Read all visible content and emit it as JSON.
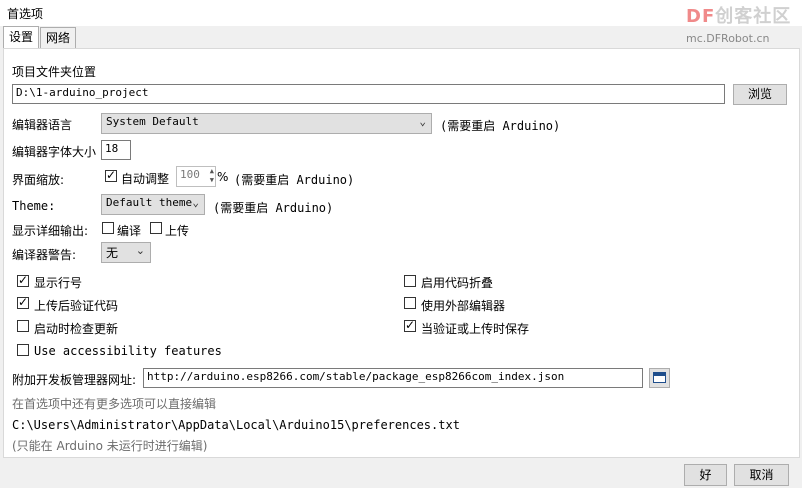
{
  "window": {
    "title": "首选项"
  },
  "watermark": {
    "logo_prefix": "DF",
    "logo_rest": "创客社区",
    "url": "mc.DFRobot.cn"
  },
  "tabs": [
    {
      "label": "设置",
      "active": true
    },
    {
      "label": "网络",
      "active": false
    }
  ],
  "sketchbook": {
    "label": "项目文件夹位置",
    "value": "D:\\1-arduino_project",
    "browse_label": "浏览"
  },
  "editor_language": {
    "label": "编辑器语言",
    "value": "System Default",
    "note": "(需要重启 Arduino)"
  },
  "editor_font_size": {
    "label": "编辑器字体大小",
    "value": "18"
  },
  "interface_scale": {
    "label": "界面缩放:",
    "auto_label": "自动调整",
    "auto_checked": true,
    "value": "100",
    "unit": "%",
    "note": "(需要重启 Arduino)"
  },
  "theme": {
    "label": "Theme:",
    "value": "Default theme",
    "note": "(需要重启 Arduino)"
  },
  "verbose_output": {
    "label": "显示详细输出:",
    "compile_label": "编译",
    "compile_checked": false,
    "upload_label": "上传",
    "upload_checked": false
  },
  "compiler_warnings": {
    "label": "编译器警告:",
    "value": "无"
  },
  "options_left": [
    {
      "label": "显示行号",
      "checked": true
    },
    {
      "label": "上传后验证代码",
      "checked": true
    },
    {
      "label": "启动时检查更新",
      "checked": false
    },
    {
      "label": "Use accessibility features",
      "checked": false
    }
  ],
  "options_right": [
    {
      "label": "启用代码折叠",
      "checked": false
    },
    {
      "label": "使用外部编辑器",
      "checked": false
    },
    {
      "label": "当验证或上传时保存",
      "checked": true
    }
  ],
  "board_manager_urls": {
    "label": "附加开发板管理器网址:",
    "value": "http://arduino.esp8266.com/stable/package_esp8266com_index.json"
  },
  "more_prefs": {
    "text": "在首选项中还有更多选项可以直接编辑",
    "path": "C:\\Users\\Administrator\\AppData\\Local\\Arduino15\\preferences.txt",
    "note": "(只能在 Arduino 未运行时进行编辑)"
  },
  "footer": {
    "ok_label": "好",
    "cancel_label": "取消"
  },
  "icons": {
    "dropdown": "chevron-down-icon",
    "spinner": "spinner-arrows-icon",
    "window_list": "window-list-icon"
  }
}
